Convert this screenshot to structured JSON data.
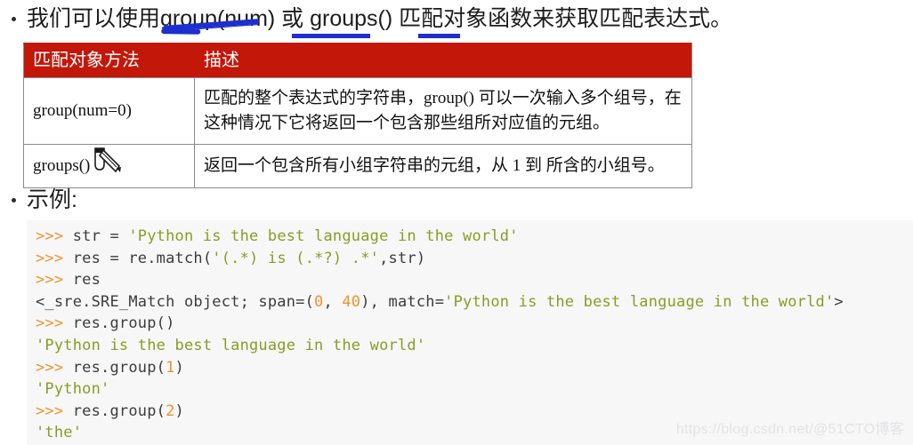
{
  "slide": {
    "intro_bullet": "我们可以使用group(num) 或 groups() 匹配对象函数来获取匹配表达式。",
    "example_bullet": "示例:"
  },
  "annotations": {
    "accent_color": "#1d2fd0",
    "marks": [
      {
        "name": "diagonal-stroke-over-group-num",
        "target_text": "group(num"
      },
      {
        "name": "underline-huo-groups",
        "target_text": "或 groups"
      },
      {
        "name": "underline-pipei",
        "target_text": "匹配"
      }
    ]
  },
  "table": {
    "header_bg": "#C3170A",
    "header_fg": "#FFFFFF",
    "columns": [
      "匹配对象方法",
      "描述"
    ],
    "rows": [
      {
        "method": "group(num=0)",
        "description": "匹配的整个表达式的字符串，group() 可以一次输入多个组号，在这种情况下它将返回一个包含那些组所对应值的元组。"
      },
      {
        "method": "groups()",
        "description": "返回一个包含所有小组字符串的元组，从 1 到 所含的小组号。"
      }
    ]
  },
  "code": {
    "background": "#f7f7f8",
    "colors": {
      "prompt": "#f0922b",
      "string": "#8a9c22",
      "number": "#f0922b",
      "plain": "#3c3c3c"
    },
    "lines": [
      {
        "prompt": ">>> ",
        "pre": "str = ",
        "str": "'Python is the best language in the world'",
        "post": ""
      },
      {
        "prompt": ">>> ",
        "pre": "res = re.match(",
        "str": "'(.*) is (.*?) .*'",
        "post": ",str)"
      },
      {
        "prompt": ">>> ",
        "pre": "res",
        "str": "",
        "post": ""
      },
      {
        "prompt": "",
        "pre": "<_sre.SRE_Match object; span=(",
        "num1": "0",
        "mid1": ", ",
        "num2": "40",
        "mid2": "), match=",
        "str": "'Python is the best language in the world'",
        "post": ">"
      },
      {
        "prompt": ">>> ",
        "pre": "res.group()",
        "str": "",
        "post": ""
      },
      {
        "prompt": "",
        "pre": "",
        "str": "'Python is the best language in the world'",
        "post": ""
      },
      {
        "prompt": ">>> ",
        "pre": "res.group(",
        "num1": "1",
        "mid2": "",
        "post": ")"
      },
      {
        "prompt": "",
        "pre": "",
        "str": "'Python'",
        "post": ""
      },
      {
        "prompt": ">>> ",
        "pre": "res.group(",
        "num1": "2",
        "mid2": "",
        "post": ")"
      },
      {
        "prompt": "",
        "pre": "",
        "str": "'the'",
        "post": ""
      }
    ]
  },
  "watermark": {
    "text": "https://blog.csdn.net/@51CTO博客"
  }
}
